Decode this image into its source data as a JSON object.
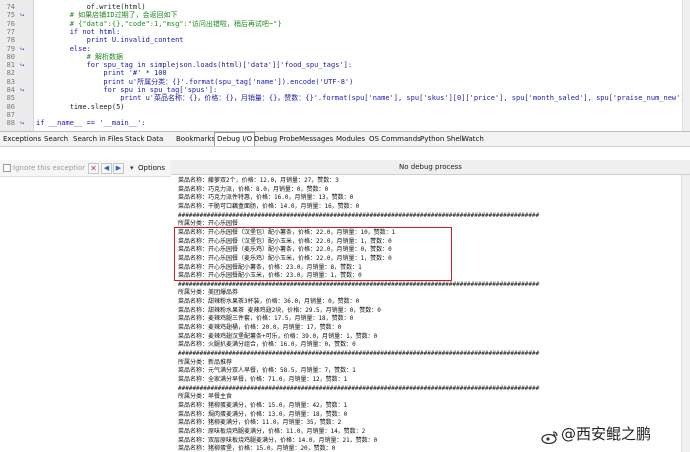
{
  "editor": {
    "lines": [
      {
        "num": "74",
        "text": "            of.write(html)"
      },
      {
        "num": "75",
        "text": "        # 如果店铺ID过期了，会返回如下"
      },
      {
        "num": "76",
        "text": "        # {\"data\":{},\"code\":1,\"msg\":\"访问出错啦，稍后再试吧~\"}"
      },
      {
        "num": "77",
        "text": "        if not html:"
      },
      {
        "num": "78",
        "text": "            print U.invalid_content"
      },
      {
        "num": "79",
        "text": "        else:"
      },
      {
        "num": "80",
        "text": "            # 解析数据"
      },
      {
        "num": "81",
        "text": "            for spu_tag in simplejson.loads(html)['data']['food_spu_tags']:"
      },
      {
        "num": "82",
        "text": "                print '#' * 100"
      },
      {
        "num": "83",
        "text": "                print u'所属分类：{}'.format(spu_tag['name']).encode('UTF-8')"
      },
      {
        "num": "84",
        "text": "                for spu in spu_tag['spus']:"
      },
      {
        "num": "85",
        "text": "                    print u'菜品名称：{}，价格：{}，月销量：{}，赞数：{}'.format(spu['name'], spu['skus'][0]['price'], spu['month_saled'], spu['praise_num_new']).encode('UTF-8')"
      },
      {
        "num": "86",
        "text": "        time.sleep(5)"
      },
      {
        "num": "87",
        "text": ""
      },
      {
        "num": "88",
        "text": "if __name__ == '__main__':"
      }
    ]
  },
  "toolbar": {
    "tabs": [
      "Exceptions",
      "Search",
      "Search in Files",
      "Stack Data",
      "Bookmarks",
      "Debug I/O",
      "Debug Probe",
      "Messages",
      "Modules",
      "OS Commands",
      "Python Shell",
      "Watch"
    ],
    "active_tab": "Debug I/O"
  },
  "left_panel": {
    "ignore_label": "Ignore this exception l",
    "options_label": "Options"
  },
  "output_header": "No debug process",
  "output": {
    "lines": [
      "菜品名称：藤萝双2个，价格：12.0，月销量：27，赞数：3",
      "菜品名称：巧克力派，价格：8.0，月销量：0，赞数：0",
      "菜品名称：巧克力派件特惠，价格：16.0，月销量：13，赞数：0",
      "菜品名称：干脆可口藕盒面肠，价格：14.0，月销量：16，赞数：0",
      "####################################################################################################",
      "所属分类：开心乐园餐",
      "菜品名称：开心乐园餐（汉堡包）配小薯条，价格：22.0，月销量：10，赞数：1",
      "菜品名称：开心乐园餐（汉堡包）配小玉米，价格：22.0，月销量：1，赞数：0",
      "菜品名称：开心乐园餐（麦乐鸡）配小薯条，价格：22.0，月销量：0，赞数：0",
      "菜品名称：开心乐园餐（麦乐鸡）配小玉米，价格：22.0，月销量：1，赞数：0",
      "菜品名称：开心乐园餐配小薯条，价格：23.0，月销量：8，赞数：1",
      "菜品名称：开心乐园餐配小玉米，价格：23.0，月销量：1，赞数：0",
      "####################################################################################################",
      "所属分类：美团爆品券",
      "菜品名称：甜辣粉水果茶3杯装，价格：36.0，月销量：0，赞数：0",
      "菜品名称：甜辣粉水果茶 麦辣鸡翅2块，价格：29.5，月销量：0，赞数：0",
      "菜品名称：麦辣鸡腿三件套，价格：17.5，月销量：18，赞数：0",
      "菜品名称：麦辣鸡翅桶，价格：20.0，月销量：17，赞数：0",
      "菜品名称：麦辣鸡翅汉堡配薯条+可乐，价格：39.0，月销量：1，赞数：0",
      "菜品名称：火腿扒麦满分组合，价格：16.0，月销量：0，赞数：0",
      "####################################################################################################",
      "所属分类：新品推荐",
      "菜品名称：元气满分双人早餐，价格：58.5，月销量：7，赞数：1",
      "菜品名称：全家满分早餐，价格：71.0，月销量：12，赞数：1",
      "####################################################################################################",
      "所属分类：早餐主食",
      "菜品名称：猪柳蛋麦满分，价格：15.0，月销量：42，赞数：1",
      "菜品名称：焗肉蛋麦满分，价格：13.0，月销量：18，赞数：0",
      "菜品名称：猪柳麦满分，价格：11.0，月销量：35，赞数：2",
      "菜品名称：原味板烧鸡腿麦满分，价格：11.0，月销量：14，赞数：2",
      "菜品名称：双层原味板烧鸡腿麦满分，价格：14.0，月销量：21，赞数：0",
      "菜品名称：猪柳蛋堡，价格：15.0，月销量：20，赞数：0"
    ]
  },
  "watermark": "@西安鲲之鹏"
}
